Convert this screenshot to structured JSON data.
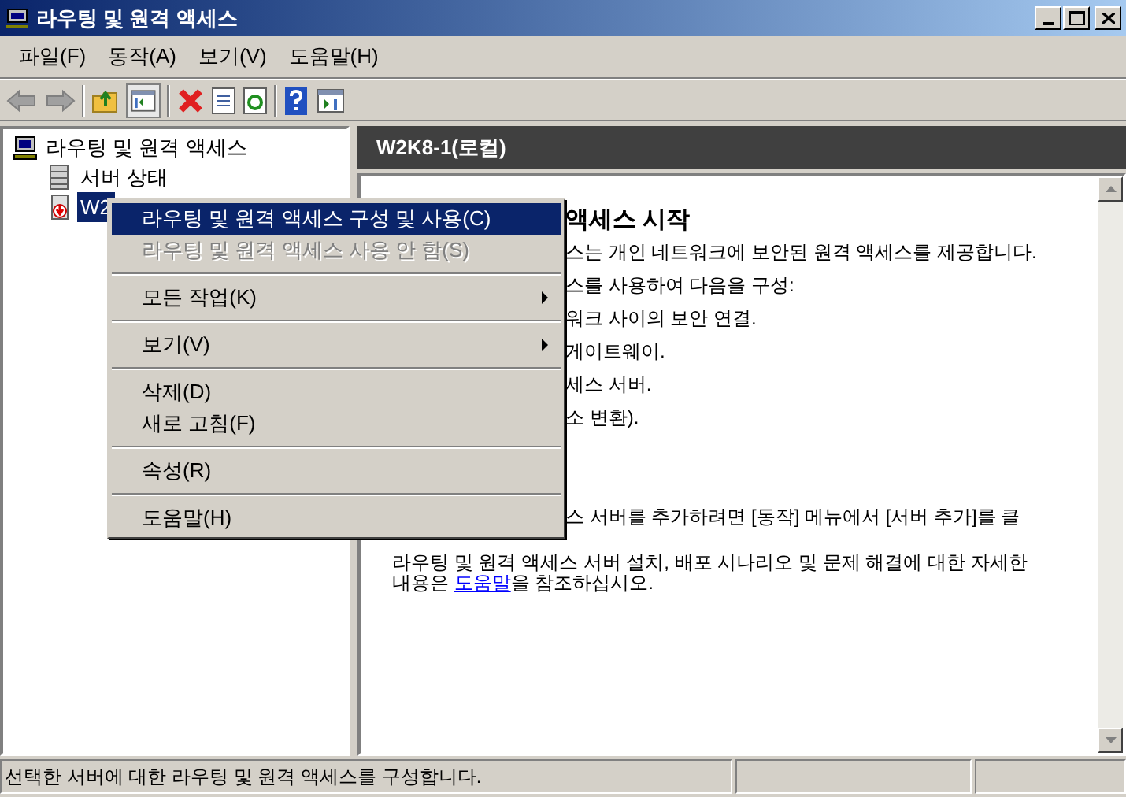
{
  "window": {
    "title": "라우팅 및 원격 액세스"
  },
  "menu_bar": [
    {
      "label": "파일(F)"
    },
    {
      "label": "동작(A)"
    },
    {
      "label": "보기(V)"
    },
    {
      "label": "도움말(H)"
    }
  ],
  "tree": [
    {
      "label": "라우팅 및 원격 액세스",
      "kind": "root",
      "selected": false,
      "children": [
        {
          "label": "서버 상태",
          "kind": "status",
          "selected": false
        },
        {
          "label": "W2",
          "kind": "server",
          "selected": true
        }
      ]
    }
  ],
  "details": {
    "header": "W2K8-1(로컬)",
    "title": "액세스 시작",
    "lines": [
      "스는 개인 네트워크에 보안된 원격 액세스를 제공합니다.",
      "스를 사용하여 다음을 구성:",
      "워크 사이의 보안 연결.",
      "게이트웨이.",
      "세스 서버.",
      "소 변환)."
    ],
    "note": "스 서버를 추가하려면 [동작] 메뉴에서 [서버 추가]를 클",
    "footer_line": "라우팅 및 원격 액세스 서버 설치, 배포 시나리오 및 문제 해결에 대한 자세한",
    "footer_before": "내용은 ",
    "footer_link": "도움말",
    "footer_after": "을 참조하십시오."
  },
  "context_menu": [
    {
      "kind": "item",
      "label": "라우팅 및 원격 액세스 구성 및 사용(C)",
      "selected": true,
      "disabled": false,
      "submenu": false
    },
    {
      "kind": "item",
      "label": "라우팅 및 원격 액세스 사용 안 함(S)",
      "selected": false,
      "disabled": true,
      "submenu": false
    },
    {
      "kind": "separator"
    },
    {
      "kind": "item",
      "label": "모든 작업(K)",
      "selected": false,
      "disabled": false,
      "submenu": true
    },
    {
      "kind": "separator"
    },
    {
      "kind": "item",
      "label": "보기(V)",
      "selected": false,
      "disabled": false,
      "submenu": true
    },
    {
      "kind": "separator"
    },
    {
      "kind": "item",
      "label": "삭제(D)",
      "selected": false,
      "disabled": false,
      "submenu": false
    },
    {
      "kind": "item",
      "label": "새로 고침(F)",
      "selected": false,
      "disabled": false,
      "submenu": false
    },
    {
      "kind": "separator"
    },
    {
      "kind": "item",
      "label": "속성(R)",
      "selected": false,
      "disabled": false,
      "submenu": false
    },
    {
      "kind": "separator"
    },
    {
      "kind": "item",
      "label": "도움말(H)",
      "selected": false,
      "disabled": false,
      "submenu": false
    }
  ],
  "status_bar": {
    "text": "선택한 서버에 대한 라우팅 및 원격 액세스를 구성합니다."
  }
}
